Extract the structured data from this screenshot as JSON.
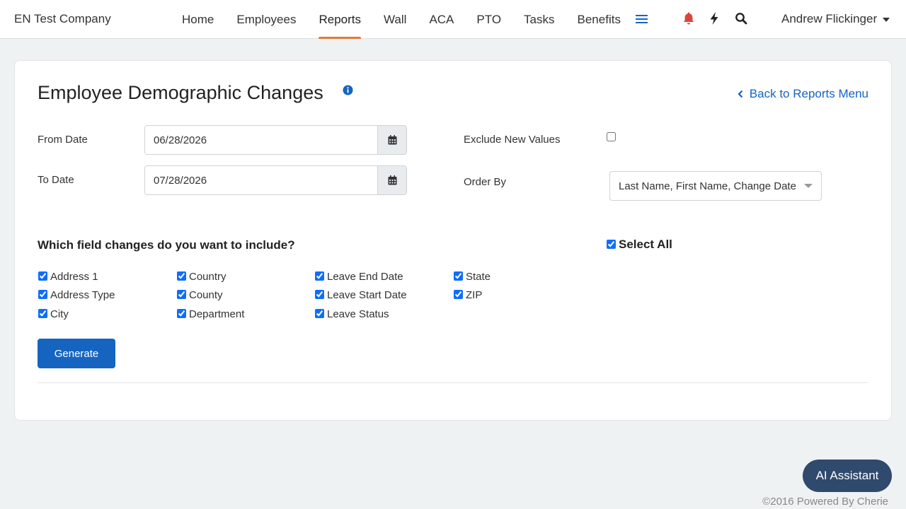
{
  "header": {
    "company": "EN Test Company",
    "nav": [
      "Home",
      "Employees",
      "Reports",
      "Wall",
      "ACA",
      "PTO",
      "Tasks",
      "Benefits"
    ],
    "active_nav": "Reports",
    "user": "Andrew Flickinger",
    "icons": [
      "menu-icon",
      "bell-icon",
      "lightning-icon",
      "search-icon"
    ]
  },
  "page": {
    "title": "Employee Demographic Changes",
    "back_link": "Back to Reports Menu"
  },
  "form": {
    "from_date_label": "From Date",
    "from_date_value": "06/28/2026",
    "to_date_label": "To Date",
    "to_date_value": "07/28/2026",
    "exclude_label": "Exclude New Values",
    "exclude_checked": false,
    "order_by_label": "Order By",
    "order_by_value": "Last Name, First Name, Change Date",
    "question": "Which field changes do you want to include?",
    "select_all_label": "Select All",
    "select_all_checked": true,
    "fields": [
      "Address 1",
      "Address Type",
      "City",
      "Country",
      "County",
      "Department",
      "Leave End Date",
      "Leave Start Date",
      "Leave Status",
      "State",
      "ZIP"
    ],
    "generate_label": "Generate"
  },
  "ai_button": "AI Assistant",
  "footer": "©2016 Powered By Cherie",
  "colors": {
    "accent": "#1565c0",
    "active_underline": "#e07b39",
    "bell": "#d9453b",
    "ai_button": "#2f4a6d"
  }
}
